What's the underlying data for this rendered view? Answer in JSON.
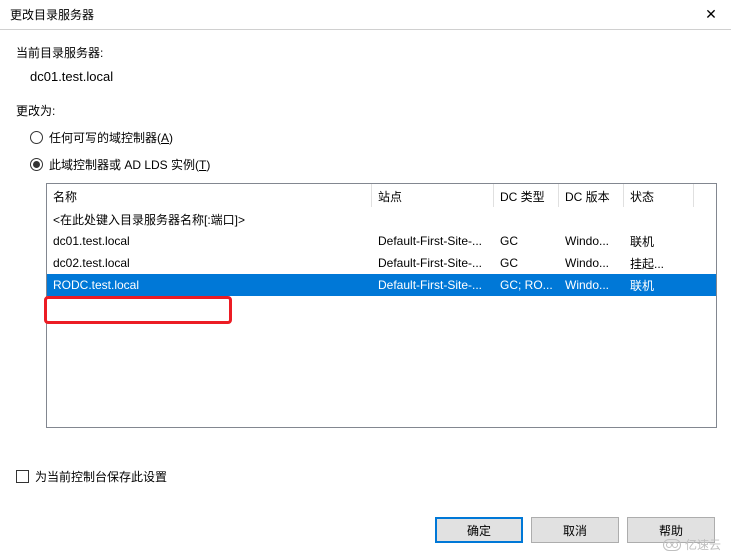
{
  "title": "更改目录服务器",
  "labels": {
    "current_server_label": "当前目录服务器:",
    "current_server_value": "dc01.test.local",
    "change_to": "更改为:",
    "radio_any_writable": "任何可写的域控制器(",
    "radio_any_writable_hotkey": "A",
    "radio_any_writable_suffix": ")",
    "radio_this_dc": "此域控制器或 AD LDS 实例(",
    "radio_this_dc_hotkey": "T",
    "radio_this_dc_suffix": ")",
    "save_setting": "为当前控制台保存此设置"
  },
  "columns": {
    "name": "名称",
    "site": "站点",
    "dctype": "DC 类型",
    "dcver": "DC 版本",
    "status": "状态"
  },
  "placeholder_row": "<在此处键入目录服务器名称[:端口]>",
  "rows": [
    {
      "name": "dc01.test.local",
      "site": "Default-First-Site-...",
      "dctype": "GC",
      "dcver": "Windo...",
      "status": "联机"
    },
    {
      "name": "dc02.test.local",
      "site": "Default-First-Site-...",
      "dctype": "GC",
      "dcver": "Windo...",
      "status": "挂起..."
    },
    {
      "name": "RODC.test.local",
      "site": "Default-First-Site-...",
      "dctype": "GC; RO...",
      "dcver": "Windo...",
      "status": "联机"
    }
  ],
  "buttons": {
    "ok": "确定",
    "cancel": "取消",
    "help": "帮助"
  },
  "watermark": "亿速云"
}
